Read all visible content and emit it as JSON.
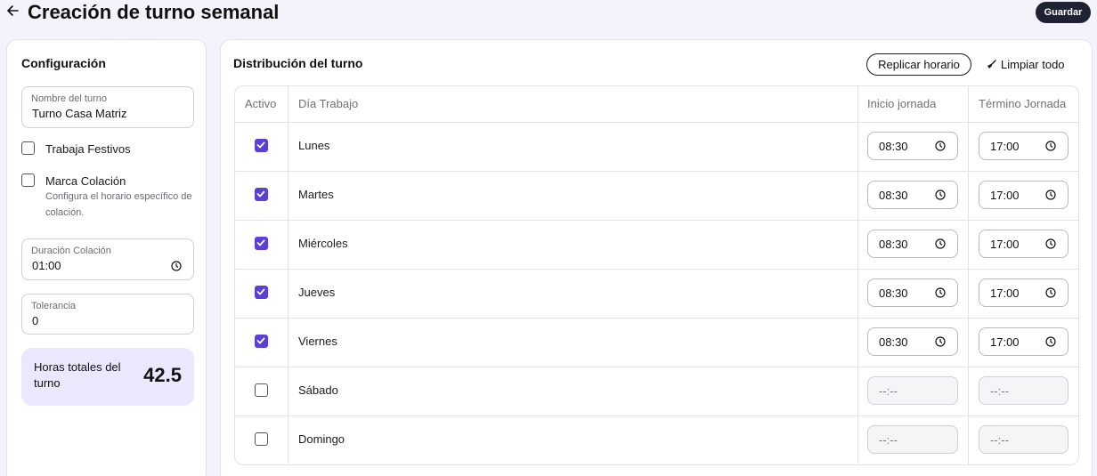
{
  "header": {
    "title": "Creación de turno semanal",
    "save_label": "Guardar"
  },
  "config": {
    "title": "Configuración",
    "shift_name": {
      "label": "Nombre del turno",
      "value": "Turno Casa Matriz"
    },
    "holidays": {
      "label": "Trabaja Festivos",
      "checked": false
    },
    "lunch_mark": {
      "label": "Marca Colación",
      "description": "Configura el horario específico de colación.",
      "checked": false
    },
    "lunch_duration": {
      "label": "Duración Colación",
      "value": "01:00"
    },
    "tolerance": {
      "label": "Tolerancia",
      "value": "0"
    },
    "total": {
      "label": "Horas totales del turno",
      "value": "42.5"
    }
  },
  "distribution": {
    "title": "Distribución del turno",
    "replicate_label": "Replicar horario",
    "clear_label": "Limpiar todo",
    "columns": {
      "active": "Activo",
      "day": "Día Trabajo",
      "start": "Inicio jornada",
      "end": "Término Jornada"
    },
    "rows": [
      {
        "day": "Lunes",
        "active": true,
        "start": "08:30",
        "end": "17:00"
      },
      {
        "day": "Martes",
        "active": true,
        "start": "08:30",
        "end": "17:00"
      },
      {
        "day": "Miércoles",
        "active": true,
        "start": "08:30",
        "end": "17:00"
      },
      {
        "day": "Jueves",
        "active": true,
        "start": "08:30",
        "end": "17:00"
      },
      {
        "day": "Viernes",
        "active": true,
        "start": "08:30",
        "end": "17:00"
      },
      {
        "day": "Sábado",
        "active": false,
        "start": "--:--",
        "end": "--:--"
      },
      {
        "day": "Domingo",
        "active": false,
        "start": "--:--",
        "end": "--:--"
      }
    ]
  },
  "colors": {
    "accent": "#5b3fd6",
    "total_bg": "#ebe7fc",
    "save_bg": "#1f2233"
  }
}
